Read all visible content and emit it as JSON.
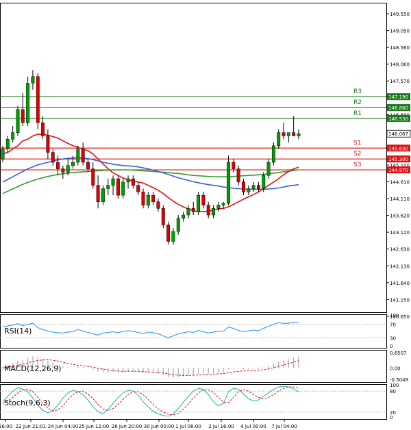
{
  "chart_data": [
    {
      "type": "candlestick",
      "name": "price",
      "ylim": [
        140.65,
        150.04
      ],
      "y_ticks": [
        "149.550",
        "149.050",
        "148.560",
        "148.060",
        "147.570",
        "147.080",
        "146.590",
        "146.100",
        "145.610",
        "145.100",
        "144.610",
        "144.110",
        "143.620",
        "143.120",
        "142.630",
        "142.130",
        "141.640",
        "141.150",
        "140.650"
      ],
      "x_ticks": [
        "16:00",
        "22 Jun 21:01",
        "24 Jun 04:00",
        "25 Jun 12:00",
        "26 Jun 20:00",
        "30 Jun 00:00",
        "1 Jul 08:00",
        "2 Jul 16:00",
        "4 Jul 00:00",
        "7 Jul 04:00"
      ],
      "current_price": "146.067",
      "levels": [
        {
          "label": "R3",
          "value": 147.19,
          "price_label": "147.190",
          "color": "#1a7a1a"
        },
        {
          "label": "R2",
          "value": 146.86,
          "price_label": "146.860",
          "color": "#1a7a1a"
        },
        {
          "label": "R1",
          "value": 146.53,
          "price_label": "146.530",
          "color": "#1a7a1a"
        },
        {
          "label": "S1",
          "value": 145.63,
          "price_label": "145.630",
          "color": "#e01010"
        },
        {
          "label": "S2",
          "value": 145.3,
          "price_label": "145.300",
          "color": "#e01010"
        },
        {
          "label": "S3",
          "value": 144.97,
          "price_label": "144.970",
          "color": "#e01010"
        }
      ],
      "candles": [
        [
          145.3,
          145.7,
          145.2,
          145.6
        ],
        [
          145.6,
          146.0,
          145.5,
          145.9
        ],
        [
          145.9,
          146.3,
          145.8,
          146.1
        ],
        [
          146.1,
          146.9,
          146.0,
          146.8
        ],
        [
          146.8,
          147.3,
          146.3,
          146.4
        ],
        [
          146.4,
          147.8,
          146.3,
          147.6
        ],
        [
          147.6,
          148.0,
          147.4,
          147.8
        ],
        [
          147.8,
          147.9,
          146.2,
          146.4
        ],
        [
          146.4,
          146.6,
          145.9,
          146.0
        ],
        [
          146.0,
          146.2,
          145.3,
          145.5
        ],
        [
          145.5,
          145.6,
          145.1,
          145.2
        ],
        [
          145.2,
          145.4,
          144.8,
          145.0
        ],
        [
          145.0,
          145.1,
          144.7,
          144.9
        ],
        [
          144.9,
          145.3,
          144.8,
          145.1
        ],
        [
          145.1,
          145.4,
          145.0,
          145.2
        ],
        [
          145.2,
          145.7,
          145.1,
          145.6
        ],
        [
          145.6,
          145.8,
          145.1,
          145.2
        ],
        [
          145.2,
          145.3,
          144.9,
          145.0
        ],
        [
          145.0,
          145.2,
          144.4,
          144.5
        ],
        [
          144.5,
          144.8,
          143.8,
          144.0
        ],
        [
          144.0,
          144.5,
          143.9,
          144.4
        ],
        [
          144.4,
          144.7,
          144.2,
          144.5
        ],
        [
          144.5,
          144.8,
          144.2,
          144.7
        ],
        [
          144.7,
          144.8,
          144.1,
          144.2
        ],
        [
          144.2,
          144.7,
          144.1,
          144.6
        ],
        [
          144.6,
          144.8,
          144.4,
          144.7
        ],
        [
          144.7,
          144.8,
          144.4,
          144.5
        ],
        [
          144.5,
          144.6,
          144.2,
          144.3
        ],
        [
          144.3,
          144.4,
          143.8,
          143.9
        ],
        [
          143.9,
          144.3,
          143.8,
          144.2
        ],
        [
          144.2,
          144.3,
          143.9,
          144.0
        ],
        [
          144.0,
          144.1,
          143.7,
          143.8
        ],
        [
          143.8,
          143.9,
          143.2,
          143.3
        ],
        [
          143.3,
          143.4,
          142.7,
          142.8
        ],
        [
          142.8,
          143.2,
          142.7,
          143.1
        ],
        [
          143.1,
          143.6,
          143.0,
          143.5
        ],
        [
          143.5,
          143.7,
          143.4,
          143.6
        ],
        [
          143.6,
          143.9,
          143.5,
          143.8
        ],
        [
          143.8,
          144.0,
          143.6,
          143.7
        ],
        [
          143.7,
          144.3,
          143.6,
          144.2
        ],
        [
          144.2,
          144.3,
          143.8,
          143.9
        ],
        [
          143.9,
          144.0,
          143.5,
          143.6
        ],
        [
          143.6,
          143.9,
          143.5,
          143.8
        ],
        [
          143.8,
          144.0,
          143.7,
          143.9
        ],
        [
          143.9,
          144.0,
          143.8,
          143.95
        ],
        [
          143.95,
          145.4,
          143.9,
          145.2
        ],
        [
          145.2,
          145.3,
          144.9,
          145.0
        ],
        [
          145.0,
          145.1,
          144.5,
          144.6
        ],
        [
          144.6,
          144.7,
          144.2,
          144.3
        ],
        [
          144.3,
          144.5,
          144.2,
          144.4
        ],
        [
          144.4,
          144.6,
          144.3,
          144.5
        ],
        [
          144.5,
          144.6,
          144.3,
          144.4
        ],
        [
          144.4,
          144.9,
          144.3,
          144.8
        ],
        [
          144.8,
          145.3,
          144.7,
          145.2
        ],
        [
          145.2,
          145.8,
          145.1,
          145.7
        ],
        [
          145.7,
          146.2,
          145.6,
          146.1
        ],
        [
          146.1,
          146.4,
          145.9,
          146.0
        ],
        [
          146.0,
          146.1,
          145.8,
          146.1
        ],
        [
          146.1,
          146.6,
          146.0,
          146.0
        ],
        [
          146.0,
          146.2,
          145.9,
          146.067
        ]
      ],
      "ma_red": [
        145.45,
        145.5,
        145.6,
        145.7,
        145.85,
        145.9,
        146.0,
        146.05,
        146.05,
        146.02,
        145.98,
        145.93,
        145.85,
        145.77,
        145.7,
        145.65,
        145.6,
        145.55,
        145.45,
        145.3,
        145.15,
        145.0,
        144.88,
        144.8,
        144.72,
        144.67,
        144.63,
        144.6,
        144.57,
        144.5,
        144.43,
        144.35,
        144.25,
        144.13,
        144.02,
        143.92,
        143.85,
        143.78,
        143.73,
        143.7,
        143.7,
        143.72,
        143.75,
        143.78,
        143.8,
        143.85,
        143.92,
        144.0,
        144.08,
        144.15,
        144.22,
        144.3,
        144.4,
        144.5,
        144.6,
        144.7,
        144.82,
        144.92,
        145.0,
        145.05
      ],
      "ma_blue": [
        144.6,
        144.68,
        144.76,
        144.84,
        144.92,
        145.0,
        145.06,
        145.12,
        145.16,
        145.2,
        145.24,
        145.27,
        145.3,
        145.32,
        145.33,
        145.34,
        145.33,
        145.31,
        145.28,
        145.24,
        145.2,
        145.17,
        145.14,
        145.12,
        145.1,
        145.09,
        145.08,
        145.06,
        145.03,
        145.0,
        144.96,
        144.92,
        144.88,
        144.83,
        144.78,
        144.73,
        144.69,
        144.65,
        144.61,
        144.58,
        144.55,
        144.52,
        144.5,
        144.48,
        144.45,
        144.43,
        144.41,
        144.4,
        144.39,
        144.38,
        144.38,
        144.38,
        144.38,
        144.39,
        144.4,
        144.42,
        144.45,
        144.48,
        144.5,
        144.52
      ],
      "ma_green": [
        144.25,
        144.32,
        144.39,
        144.46,
        144.53,
        144.59,
        144.64,
        144.69,
        144.73,
        144.77,
        144.8,
        144.83,
        144.85,
        144.87,
        144.89,
        144.9,
        144.91,
        144.92,
        144.93,
        144.94,
        144.95,
        144.96,
        144.97,
        144.97,
        144.97,
        144.97,
        144.96,
        144.95,
        144.94,
        144.93,
        144.92,
        144.91,
        144.9,
        144.89,
        144.87,
        144.86,
        144.84,
        144.82,
        144.8,
        144.79,
        144.78,
        144.77,
        144.76,
        144.76,
        144.76,
        144.76,
        144.77,
        144.78,
        144.79,
        144.8,
        144.81,
        144.82,
        144.83,
        144.85,
        144.87,
        144.89,
        144.91,
        144.93,
        144.95,
        144.97
      ]
    },
    {
      "type": "line",
      "name": "RSI(14)",
      "ylim": [
        0,
        100
      ],
      "y_ticks": [
        "100",
        "70",
        "30",
        "0"
      ],
      "values": [
        62,
        65,
        68,
        72,
        66,
        70,
        73,
        60,
        55,
        50,
        47,
        45,
        44,
        47,
        48,
        55,
        50,
        46,
        42,
        38,
        44,
        46,
        48,
        45,
        49,
        51,
        49,
        46,
        42,
        47,
        45,
        42,
        36,
        30,
        36,
        42,
        45,
        48,
        46,
        52,
        48,
        44,
        47,
        49,
        50,
        62,
        58,
        52,
        48,
        51,
        53,
        51,
        58,
        64,
        70,
        75,
        73,
        73,
        76,
        74
      ]
    },
    {
      "type": "bar",
      "name": "MACD(12,26,9)",
      "ylim": [
        -0.5049,
        0.6507
      ],
      "y_ticks": [
        "0.6507",
        "0.00",
        "-0.5049"
      ],
      "values": [
        0.05,
        0.12,
        0.18,
        0.26,
        0.3,
        0.36,
        0.42,
        0.4,
        0.34,
        0.27,
        0.19,
        0.12,
        0.06,
        0.03,
        0.02,
        0.05,
        0.04,
        0.0,
        -0.06,
        -0.13,
        -0.16,
        -0.17,
        -0.16,
        -0.17,
        -0.15,
        -0.13,
        -0.12,
        -0.13,
        -0.16,
        -0.17,
        -0.18,
        -0.2,
        -0.26,
        -0.33,
        -0.35,
        -0.33,
        -0.3,
        -0.27,
        -0.25,
        -0.2,
        -0.19,
        -0.2,
        -0.19,
        -0.17,
        -0.15,
        -0.05,
        -0.02,
        -0.03,
        -0.05,
        -0.04,
        -0.03,
        -0.03,
        0.02,
        0.08,
        0.15,
        0.23,
        0.28,
        0.32,
        0.38,
        0.42
      ],
      "signal": [
        0.0,
        0.03,
        0.06,
        0.1,
        0.14,
        0.18,
        0.23,
        0.27,
        0.29,
        0.3,
        0.28,
        0.25,
        0.21,
        0.17,
        0.13,
        0.1,
        0.08,
        0.06,
        0.03,
        -0.01,
        -0.04,
        -0.07,
        -0.09,
        -0.11,
        -0.12,
        -0.12,
        -0.12,
        -0.12,
        -0.13,
        -0.14,
        -0.15,
        -0.16,
        -0.18,
        -0.21,
        -0.24,
        -0.26,
        -0.27,
        -0.27,
        -0.26,
        -0.25,
        -0.24,
        -0.23,
        -0.22,
        -0.21,
        -0.2,
        -0.17,
        -0.14,
        -0.12,
        -0.11,
        -0.1,
        -0.09,
        -0.08,
        -0.06,
        -0.03,
        0.01,
        0.06,
        0.11,
        0.16,
        0.21,
        0.26
      ]
    },
    {
      "type": "line",
      "name": "Stoch(9,6,3)",
      "ylim": [
        0,
        100
      ],
      "y_ticks": [
        "100",
        "80",
        "20",
        "0"
      ],
      "main": [
        50,
        65,
        80,
        90,
        85,
        78,
        60,
        40,
        25,
        18,
        25,
        40,
        60,
        75,
        82,
        78,
        70,
        55,
        35,
        22,
        15,
        28,
        45,
        62,
        75,
        82,
        80,
        68,
        50,
        35,
        22,
        15,
        10,
        8,
        15,
        30,
        48,
        65,
        80,
        88,
        85,
        70,
        50,
        38,
        45,
        78,
        88,
        85,
        72,
        58,
        52,
        55,
        65,
        75,
        85,
        92,
        94,
        92,
        86,
        78
      ],
      "signal": [
        45,
        52,
        62,
        75,
        84,
        85,
        78,
        62,
        45,
        32,
        24,
        26,
        38,
        55,
        70,
        79,
        79,
        72,
        58,
        42,
        29,
        24,
        30,
        42,
        56,
        70,
        78,
        78,
        70,
        56,
        42,
        29,
        20,
        14,
        12,
        16,
        28,
        44,
        60,
        75,
        84,
        84,
        76,
        62,
        48,
        48,
        62,
        78,
        84,
        80,
        70,
        62,
        58,
        62,
        70,
        80,
        88,
        92,
        92,
        88
      ]
    }
  ]
}
